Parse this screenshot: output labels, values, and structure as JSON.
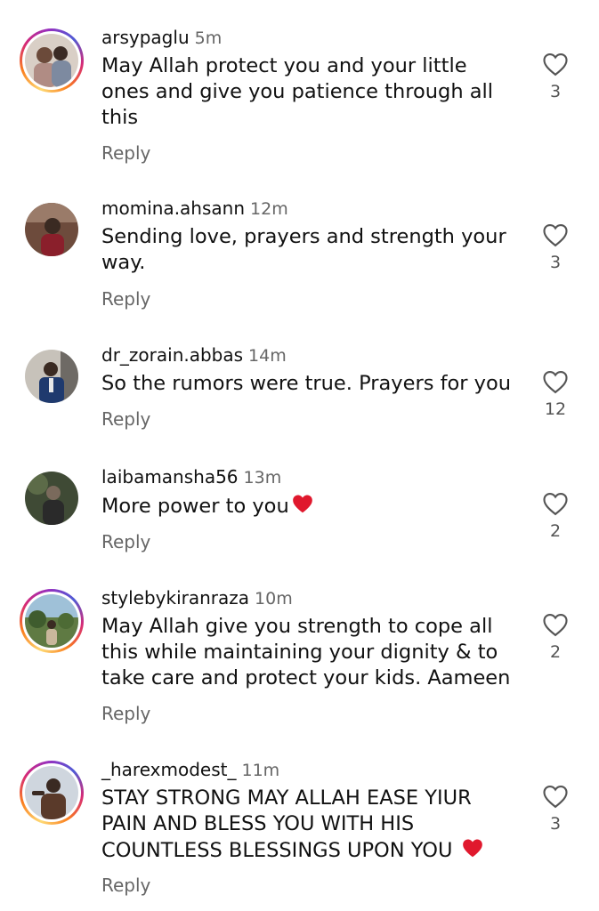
{
  "reply_label": "Reply",
  "comments": [
    {
      "username": "arsypaglu",
      "time": "5m",
      "text": "May Allah protect you and your little ones and give you patience through all this",
      "likes": "3",
      "avatar_ring": true
    },
    {
      "username": "momina.ahsann",
      "time": "12m",
      "text": "Sending love, prayers and strength your way.",
      "likes": "3",
      "avatar_ring": false
    },
    {
      "username": "dr_zorain.abbas",
      "time": "14m",
      "text": "So the rumors were true. Prayers for you",
      "likes": "12",
      "avatar_ring": false
    },
    {
      "username": "laibamansha56",
      "time": "13m",
      "text": "More power to you",
      "emoji": "red-heart-emoji",
      "likes": "2",
      "avatar_ring": false
    },
    {
      "username": "stylebykiranraza",
      "time": "10m",
      "text": "May Allah give you strength to cope all this while maintaining your dignity & to take care and protect your kids. Aameen",
      "likes": "2",
      "avatar_ring": true
    },
    {
      "username": "_harexmodest_",
      "time": "11m",
      "text": "STAY STRONG MAY ALLAH EASE YIUR PAIN AND BLESS YOU WITH HIS COUNTLESS BLESSINGS UPON YOU",
      "emoji": "red-heart-emoji",
      "likes": "3",
      "avatar_ring": true
    }
  ],
  "colors": {
    "text": "#111111",
    "meta": "#666666",
    "heart": "#e0182d"
  },
  "icons": {
    "like": "heart-outline-icon"
  }
}
